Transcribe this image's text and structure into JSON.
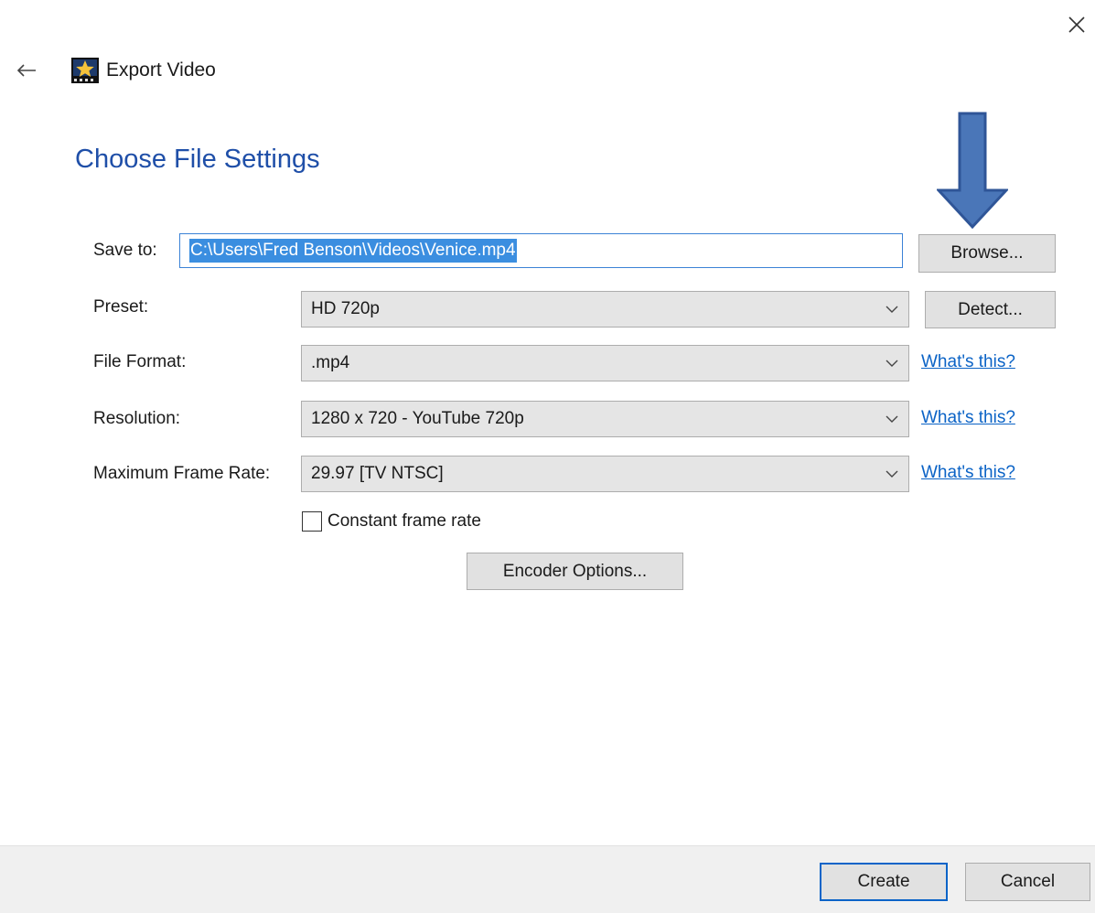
{
  "window": {
    "title": "Export Video",
    "close_icon": "close-icon",
    "back_icon": "back-arrow-icon",
    "app_icon": "app-star-icon"
  },
  "page": {
    "title": "Choose File Settings"
  },
  "form": {
    "save_to_label": "Save to:",
    "save_to_value": "C:\\Users\\Fred Benson\\Videos\\Venice.mp4",
    "browse_label": "Browse...",
    "preset_label": "Preset:",
    "preset_value": "HD 720p",
    "detect_label": "Detect...",
    "file_format_label": "File Format:",
    "file_format_value": ".mp4",
    "resolution_label": "Resolution:",
    "resolution_value": "1280 x 720 - YouTube 720p",
    "frame_rate_label": "Maximum Frame Rate:",
    "frame_rate_value": "29.97 [TV NTSC]",
    "whats_this_label": "What's this?",
    "constant_frame_rate_label": "Constant frame rate",
    "constant_frame_rate_checked": false,
    "encoder_options_label": "Encoder Options..."
  },
  "footer": {
    "create_label": "Create",
    "cancel_label": "Cancel"
  },
  "colors": {
    "title_blue": "#1f4fa8",
    "link_blue": "#0b63c6",
    "annotation_arrow": "#4a76b8",
    "selection": "#3b8ee0"
  }
}
